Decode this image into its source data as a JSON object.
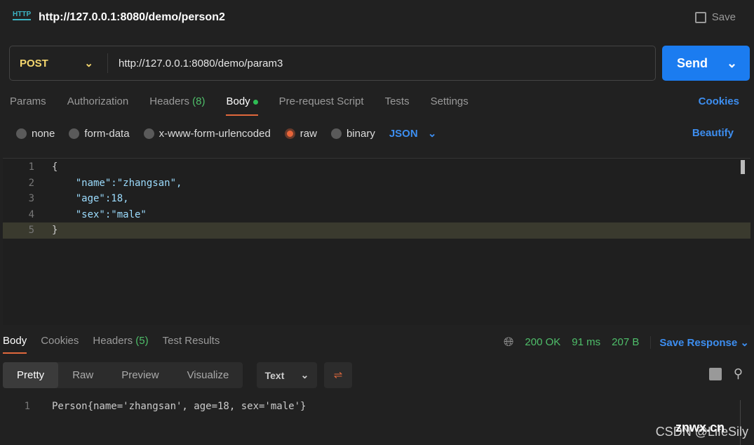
{
  "header": {
    "title": "http://127.0.0.1:8080/demo/person2",
    "icon": "http-icon",
    "save_label": "Save"
  },
  "request": {
    "method": "POST",
    "url": "http://127.0.0.1:8080/demo/param3",
    "send_label": "Send"
  },
  "tabs": [
    {
      "label": "Params"
    },
    {
      "label": "Authorization"
    },
    {
      "label": "Headers",
      "count": "(8)"
    },
    {
      "label": "Body"
    },
    {
      "label": "Pre-request Script"
    },
    {
      "label": "Tests"
    },
    {
      "label": "Settings"
    }
  ],
  "cookies_label": "Cookies",
  "body_types": [
    {
      "label": "none",
      "selected": false
    },
    {
      "label": "form-data",
      "selected": false
    },
    {
      "label": "x-www-form-urlencoded",
      "selected": false
    },
    {
      "label": "raw",
      "selected": true
    },
    {
      "label": "binary",
      "selected": false
    }
  ],
  "format": "JSON",
  "beautify_label": "Beautify",
  "editor": {
    "lines": [
      "{",
      "    \"name\":\"zhangsan\",",
      "    \"age\":18,",
      "    \"sex\":\"male\"",
      "}"
    ],
    "numbers": [
      "1",
      "2",
      "3",
      "4",
      "5"
    ]
  },
  "response": {
    "tabs": [
      {
        "label": "Body"
      },
      {
        "label": "Cookies"
      },
      {
        "label": "Headers",
        "count": "(5)"
      },
      {
        "label": "Test Results"
      }
    ],
    "status": "200 OK",
    "time": "91 ms",
    "size": "207 B",
    "save_label": "Save Response",
    "views": [
      "Pretty",
      "Raw",
      "Preview",
      "Visualize"
    ],
    "view_type": "Text",
    "line_number": "1",
    "body": "Person{name='zhangsan', age=18, sex='male'}"
  },
  "watermark": {
    "csdn": "CSDN @LifeSily",
    "site": "znwx.cn"
  },
  "colors": {
    "accent": "#e0683c",
    "send": "#1b7cf0",
    "ok": "#4fbf6a",
    "method": "#f5d76e"
  }
}
